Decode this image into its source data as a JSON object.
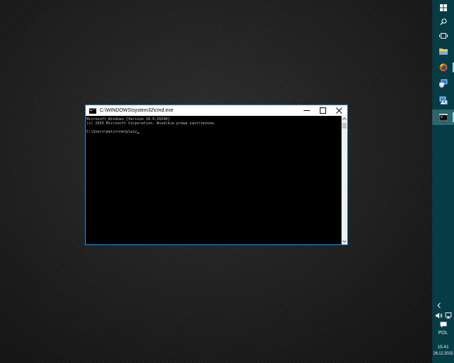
{
  "window": {
    "title": "C:\\WINDOWS\\system32\\cmd.exe",
    "minimize_icon": "minimize-icon",
    "maximize_icon": "maximize-icon",
    "close_icon": "close-icon"
  },
  "console": {
    "lines": [
      "Microsoft Windows [Version 10.0.10240]",
      "(c) 2015 Microsoft Corporation. Wszelkie prawa zastrzeżone.",
      "",
      "C:\\Users\\matit>netplwiz"
    ]
  },
  "taskbar": {
    "items": [
      {
        "icon": "windows-start-icon"
      },
      {
        "icon": "search-icon"
      },
      {
        "icon": "task-view-icon"
      },
      {
        "icon": "file-explorer-icon"
      },
      {
        "icon": "firefox-icon"
      },
      {
        "icon": "remote-desktop-icon"
      },
      {
        "icon": "network-computer-icon"
      },
      {
        "icon": "command-prompt-icon"
      }
    ],
    "tray": {
      "chevron_icon": "chevron-left-icon",
      "volume_icon": "speaker-icon",
      "network_icon": "network-icon",
      "notification_icon": "action-center-icon",
      "language": "POL",
      "time": "15:41",
      "date": "26.12.2015"
    }
  },
  "colors": {
    "taskbar_bg": "#053c46",
    "taskbar_active": "#2a6670",
    "window_border": "#2e8fd6",
    "console_text": "#c0c0c0",
    "console_bg": "#000000"
  }
}
